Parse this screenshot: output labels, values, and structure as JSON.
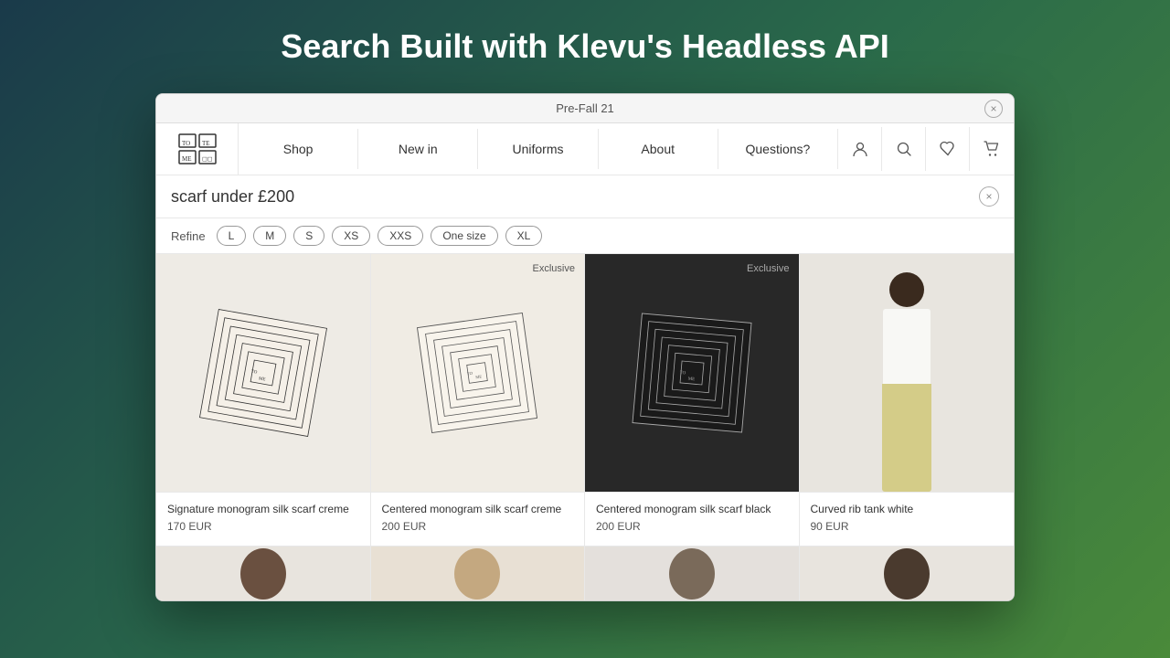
{
  "page": {
    "title": "Search Built with Klevu's Headless API"
  },
  "browser": {
    "tab_title": "Pre-Fall 21",
    "close_label": "×"
  },
  "nav": {
    "logo_alt": "Toteme logo",
    "items": [
      {
        "label": "Shop",
        "id": "shop"
      },
      {
        "label": "New in",
        "id": "new-in"
      },
      {
        "label": "Uniforms",
        "id": "uniforms"
      },
      {
        "label": "About",
        "id": "about"
      },
      {
        "label": "Questions?",
        "id": "questions"
      }
    ],
    "icons": [
      {
        "name": "account-icon",
        "symbol": "👤"
      },
      {
        "name": "search-icon",
        "symbol": "🔍"
      },
      {
        "name": "wishlist-icon",
        "symbol": "☆"
      },
      {
        "name": "cart-icon",
        "symbol": "🛍"
      }
    ]
  },
  "search": {
    "query": "scarf under £200",
    "clear_label": "×"
  },
  "refine": {
    "label": "Refine",
    "filters": [
      "L",
      "M",
      "S",
      "XS",
      "XXS",
      "One size",
      "XL"
    ]
  },
  "products": [
    {
      "id": "prod-1",
      "name": "Signature monogram silk scarf creme",
      "price": "170 EUR",
      "exclusive": false,
      "bg": "light",
      "type": "scarf-light"
    },
    {
      "id": "prod-2",
      "name": "Centered monogram silk scarf creme",
      "price": "200 EUR",
      "exclusive": true,
      "bg": "offwhite",
      "type": "scarf-offwhite"
    },
    {
      "id": "prod-3",
      "name": "Centered monogram silk scarf black",
      "price": "200 EUR",
      "exclusive": true,
      "bg": "dark",
      "type": "scarf-dark"
    },
    {
      "id": "prod-4",
      "name": "Curved rib tank white",
      "price": "90 EUR",
      "exclusive": false,
      "bg": "model",
      "type": "model"
    }
  ],
  "colors": {
    "accent": "#4a8a3a",
    "bg_gradient_start": "#1a3a4a",
    "bg_gradient_end": "#4a8a3a",
    "scarf_light_bg": "#f0ede8",
    "scarf_dark_bg": "#2a2a2a",
    "model_bg": "#e8e5df"
  }
}
